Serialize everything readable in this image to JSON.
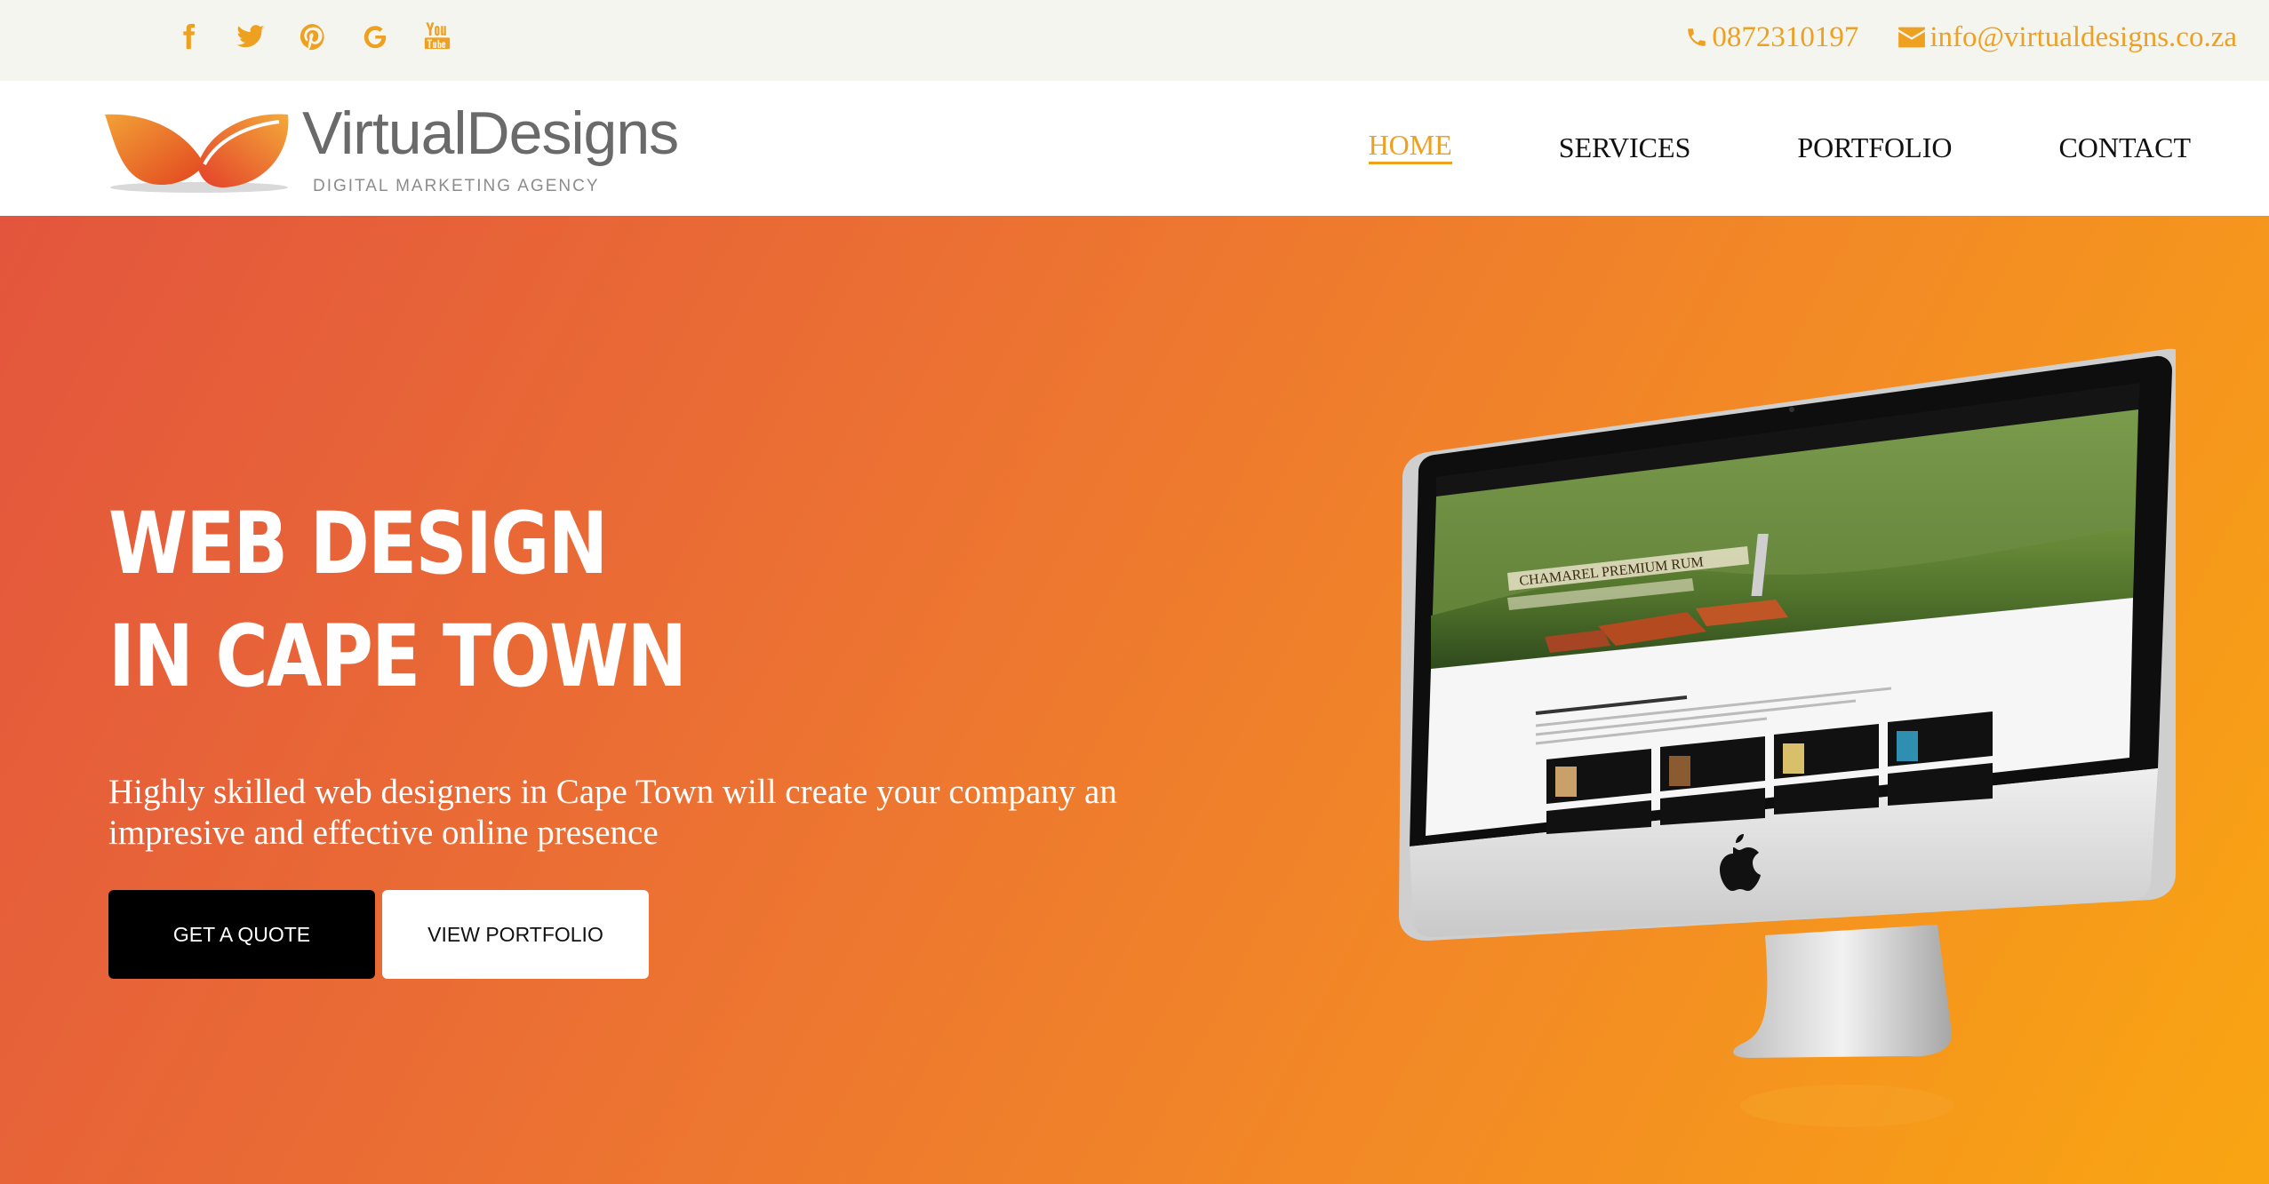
{
  "topbar": {
    "social_icons": [
      "facebook-icon",
      "twitter-icon",
      "pinterest-icon",
      "google-icon",
      "youtube-icon"
    ],
    "phone": "0872310197",
    "email": "info@virtualdesigns.co.za"
  },
  "logo": {
    "name": "VirtualDesigns",
    "tagline": "DIGITAL MARKETING AGENCY"
  },
  "nav": {
    "items": [
      {
        "label": "HOME",
        "active": true
      },
      {
        "label": "SERVICES",
        "active": false
      },
      {
        "label": "PORTFOLIO",
        "active": false
      },
      {
        "label": "CONTACT",
        "active": false
      }
    ]
  },
  "hero": {
    "title_line1": "WEB DESIGN",
    "title_line2": "IN CAPE TOWN",
    "subtitle": "Highly skilled web designers in Cape Town will create your company an impresive and effective online presence",
    "cta_primary": "GET A QUOTE",
    "cta_secondary": "VIEW PORTFOLIO",
    "screen_heading": "CHAMAREL PREMIUM RUM"
  },
  "colors": {
    "accent": "#eea021",
    "gradient_start": "#e3553d",
    "gradient_end": "#f9a512",
    "topbar_bg": "#f5f5f0"
  }
}
